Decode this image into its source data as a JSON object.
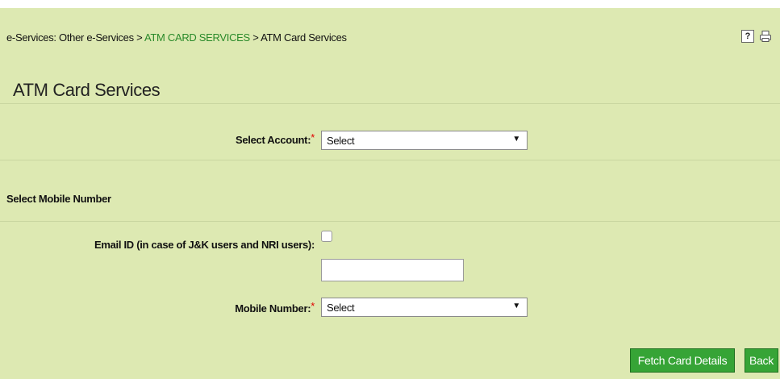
{
  "breadcrumb": {
    "part1": "e-Services: Other e-Services > ",
    "link": "ATM CARD SERVICES",
    "part2": " > ATM Card Services"
  },
  "icons": {
    "help": "?",
    "help_icon": "help-icon",
    "print_icon": "printer-icon"
  },
  "page_title": "ATM Card Services",
  "account": {
    "label": "Select Account:",
    "required_mark": "*",
    "selected": "Select"
  },
  "mobile_section": {
    "heading": "Select Mobile Number"
  },
  "email": {
    "label": "Email ID (in case of J&K users and NRI users):",
    "checked": false,
    "value": ""
  },
  "mobile": {
    "label": "Mobile Number:",
    "required_mark": "*",
    "selected": "Select"
  },
  "buttons": {
    "fetch": "Fetch Card Details",
    "back": "Back"
  },
  "colors": {
    "panel_bg": "#dde9b2",
    "link": "#2a8a2a",
    "button_bg": "#36a436",
    "required": "#e00000"
  }
}
